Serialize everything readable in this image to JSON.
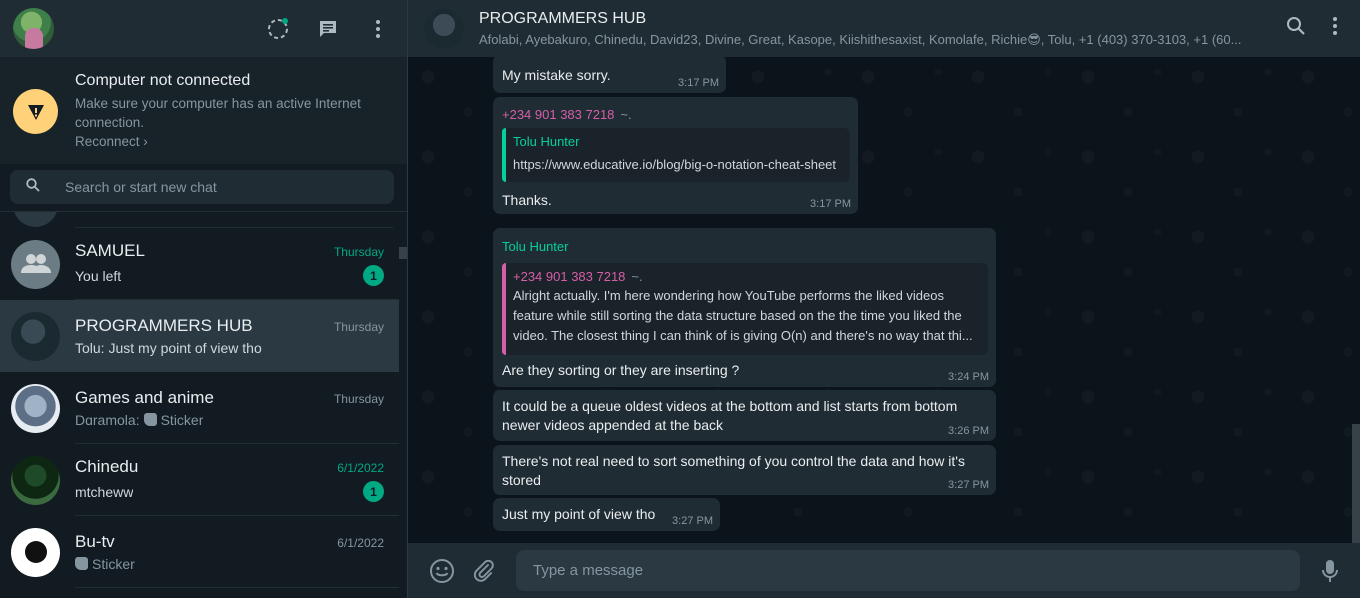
{
  "left": {
    "notice": {
      "title": "Computer not connected",
      "subtitle": "Make sure your computer has an active Internet connection.",
      "link": "Reconnect ›"
    },
    "search": {
      "placeholder": "Search or start new chat"
    },
    "chats": [
      {
        "name": "SAMUEL",
        "time": "Thursday",
        "preview": "You left",
        "unread": "1",
        "time_unread": true
      },
      {
        "name": "PROGRAMMERS HUB",
        "time": "Thursday",
        "preview": "Tolu: Just my point of view tho",
        "selected": true
      },
      {
        "name": "Games and anime",
        "time": "Thursday",
        "preview_sender": "Dɑramola:",
        "preview": "Sticker"
      },
      {
        "name": "Chinedu",
        "time": "6/1/2022",
        "preview": "mtcheww",
        "unread": "1",
        "time_unread": true
      },
      {
        "name": "Bu-tv",
        "time": "6/1/2022",
        "preview": "Sticker"
      }
    ]
  },
  "conversation": {
    "title": "PROGRAMMERS HUB",
    "members": "Afolabi, Ayebakuro, Chinedu, David23, Divine, Great, Kasope, Kiishithesaxist, Komolafe, Richie😎, Tolu, +1 (403) 370-3103, +1 (60...",
    "messages": {
      "m1": {
        "text": "My mistake sorry.",
        "time": "3:17 PM"
      },
      "m2": {
        "sender": "+234 901 383 7218",
        "sender_tail": "~.",
        "quote_author": "Tolu Hunter",
        "quote_text": "https://www.educative.io/blog/big-o-notation-cheat-sheet",
        "text": "Thanks.",
        "time": "3:17 PM"
      },
      "m3": {
        "sender": "Tolu Hunter",
        "quote_author": "+234 901 383 7218",
        "quote_author_tail": "~.",
        "quote_line1": "Alright actually. I'm here wondering how YouTube performs the liked videos",
        "quote_line2": "feature while still sorting the data structure based on the the time you liked the",
        "quote_line3": "video.  The closest thing I can think of is giving O(n) and there's no way that thi...",
        "text": "Are they sorting or they are inserting ?",
        "time": "3:24 PM"
      },
      "m4": {
        "line1": "It could be a queue oldest videos at the bottom and list starts from bottom",
        "line2": "newer videos appended at the back",
        "time": "3:26 PM"
      },
      "m5": {
        "line1": "There's not real need to sort something of you control the data and how it's",
        "line2": "stored",
        "time": "3:27 PM"
      },
      "m6": {
        "text": "Just my point of view tho",
        "time": "3:27 PM"
      }
    },
    "composer": {
      "placeholder": "Type a message"
    }
  },
  "colors": {
    "accent": "#00a884",
    "pink_sender": "#d75ea8",
    "green_sender": "#06cf9c",
    "warning": "#ffd279"
  }
}
